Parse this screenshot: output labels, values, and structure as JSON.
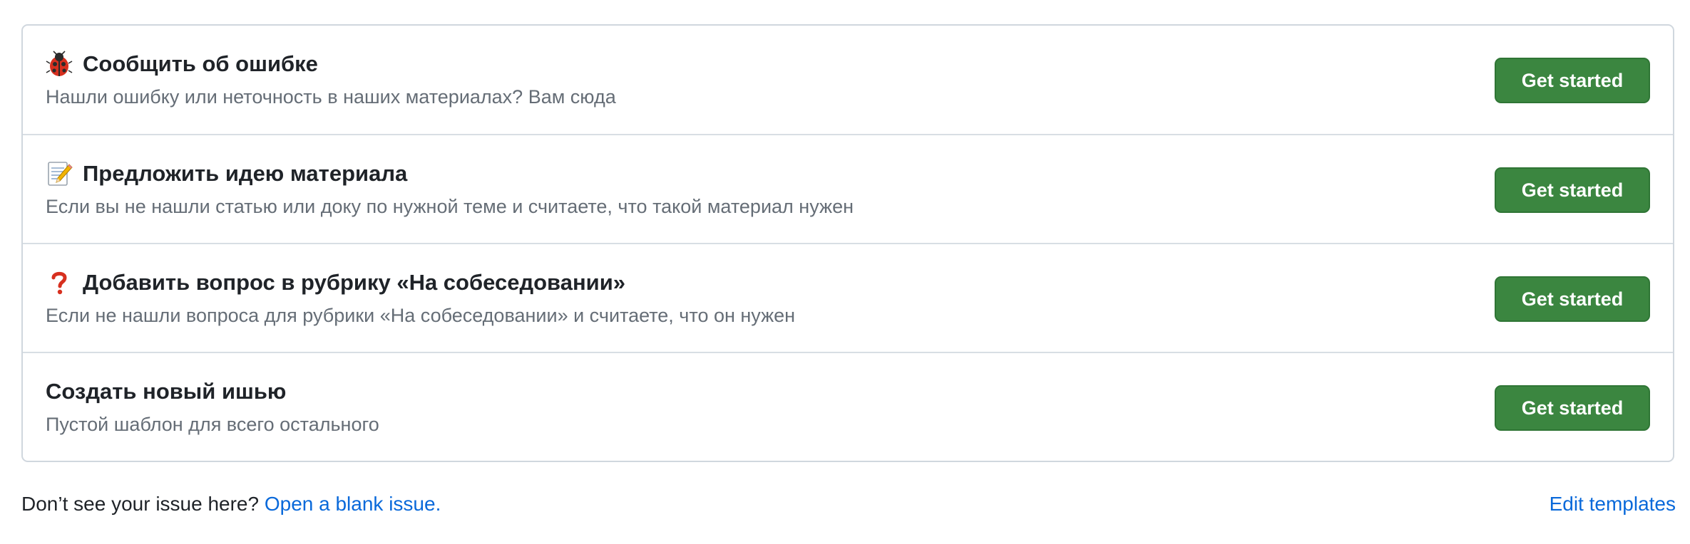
{
  "templates": [
    {
      "icon": "ladybug-icon",
      "title": "Сообщить об ошибке",
      "description": "Нашли ошибку или неточность в наших материалах? Вам сюда",
      "button_label": "Get started"
    },
    {
      "icon": "memo-icon",
      "title": "Предложить идею материала",
      "description": "Если вы не нашли статью или доку по нужной теме и считаете, что такой материал нужен",
      "button_label": "Get started"
    },
    {
      "icon": "question-mark-icon",
      "title": "Добавить вопрос в рубрику «На собеседовании»",
      "description": "Если не нашли вопроса для рубрики «На собеседовании» и считаете, что он нужен",
      "button_label": "Get started"
    },
    {
      "icon": "",
      "title": "Создать новый ишью",
      "description": "Пустой шаблон для всего остального",
      "button_label": "Get started"
    }
  ],
  "footer": {
    "prompt": "Don’t see your issue here? ",
    "blank_issue_link": "Open a blank issue.",
    "edit_templates_link": "Edit templates"
  },
  "colors": {
    "button_bg": "#3b8640",
    "link": "#0969da",
    "description": "#656d76",
    "border": "#d0d7de"
  }
}
